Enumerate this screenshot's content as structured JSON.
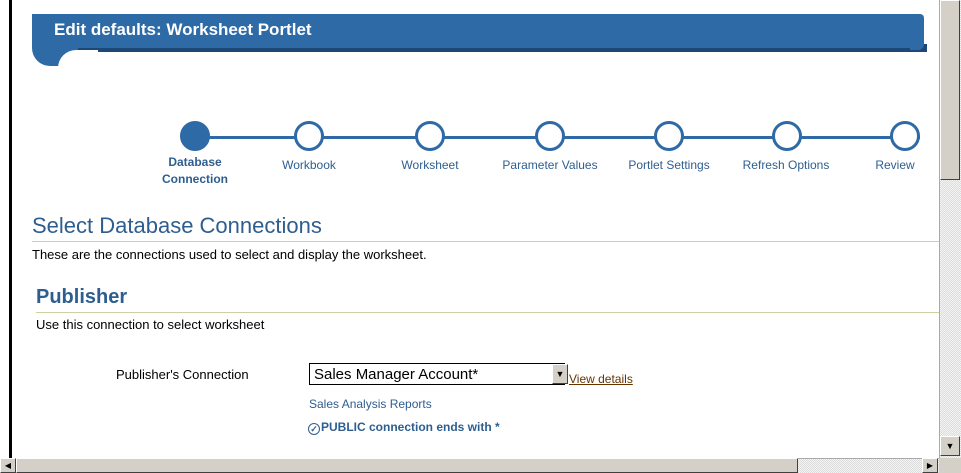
{
  "header": {
    "title": "Edit defaults: Worksheet Portlet"
  },
  "train": {
    "steps": [
      {
        "label": "Database Connection",
        "active": true
      },
      {
        "label": "Workbook",
        "active": false
      },
      {
        "label": "Worksheet",
        "active": false
      },
      {
        "label": "Parameter Values",
        "active": false
      },
      {
        "label": "Portlet Settings",
        "active": false
      },
      {
        "label": "Refresh Options",
        "active": false
      },
      {
        "label": "Review",
        "active": false
      }
    ],
    "step0_line1": "Database",
    "step0_line2": "Connection"
  },
  "section": {
    "title": "Select Database Connections",
    "description": "These are the connections used to select and display the worksheet."
  },
  "publisher": {
    "title": "Publisher",
    "description": "Use this connection to select worksheet",
    "connection_label": "Publisher's Connection",
    "connection_value": "Sales Manager Account*",
    "view_details": "View details",
    "hint": "Sales Analysis Reports",
    "note": "PUBLIC connection ends with *"
  },
  "colors": {
    "accent": "#2e6aa6",
    "text_blue": "#2e5e8f",
    "link": "#663300"
  }
}
